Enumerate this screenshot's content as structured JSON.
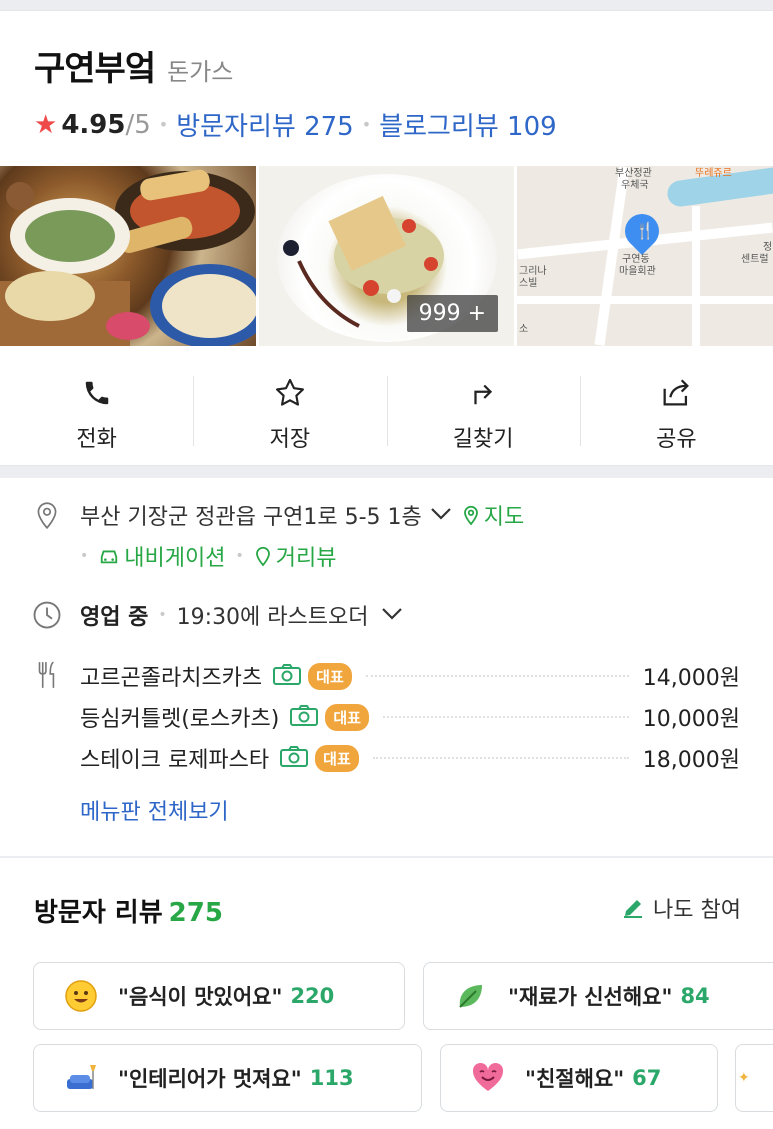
{
  "place": {
    "name": "구연부엌",
    "category": "돈가스",
    "rating_value": "4.95",
    "rating_max": "/5",
    "visitor_reviews_link": "방문자리뷰 275",
    "blog_reviews_link": "블로그리뷰 109"
  },
  "photos": {
    "more_count": "999 +",
    "map_labels": [
      "부산정관",
      "우체국",
      "뚜레쥬르",
      "구연동",
      "마을회관",
      "그리나",
      "스빌",
      "정",
      "센트럴",
      "소"
    ]
  },
  "actions": [
    {
      "label": "전화",
      "icon": "phone-icon"
    },
    {
      "label": "저장",
      "icon": "star-icon"
    },
    {
      "label": "길찾기",
      "icon": "directions-icon"
    },
    {
      "label": "공유",
      "icon": "share-icon"
    }
  ],
  "info": {
    "address": "부산 기장군 정관읍 구연1로 5-5 1층",
    "map_link": "지도",
    "navigation_link": "내비게이션",
    "streetview_link": "거리뷰",
    "open_status": "영업 중",
    "last_order": "19:30에 라스트오더",
    "menu": [
      {
        "name": "고르곤졸라치즈카츠",
        "badge": "대표",
        "price": "14,000원"
      },
      {
        "name": "등심커틀렛(로스카츠)",
        "badge": "대표",
        "price": "10,000원"
      },
      {
        "name": "스테이크 로제파스타",
        "badge": "대표",
        "price": "18,000원"
      }
    ],
    "menu_all_link": "메뉴판 전체보기"
  },
  "reviews": {
    "title": "방문자 리뷰",
    "count": "275",
    "join_label": "나도 참여",
    "keywords": [
      {
        "text": "\"음식이 맛있어요\"",
        "count": "220",
        "icon": "smile-emoji-icon"
      },
      {
        "text": "\"재료가 신선해요\"",
        "count": "84",
        "icon": "leaf-icon"
      },
      {
        "text": "\"인테리어가 멋져요\"",
        "count": "113",
        "icon": "sofa-lamp-icon"
      },
      {
        "text": "\"친절해요\"",
        "count": "67",
        "icon": "smiling-heart-icon"
      }
    ]
  },
  "colors": {
    "accent_blue": "#2f67c8",
    "accent_green": "#27a745",
    "badge_orange": "#f0a63c",
    "star_red": "#ef4a4a"
  }
}
